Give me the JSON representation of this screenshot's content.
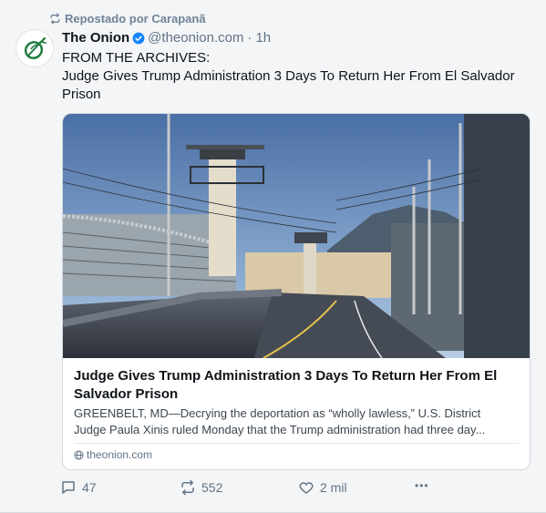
{
  "repost": {
    "label": "Repostado por Carapanã",
    "icon": "repost-icon"
  },
  "author": {
    "display_name": "The Onion",
    "verified": true,
    "handle": "@theonion.com",
    "separator": "·",
    "time": "1h",
    "avatar_icon": "onion-logo",
    "brand_color": "#1a7a3c"
  },
  "post": {
    "line1": "FROM THE ARCHIVES:",
    "line2": "Judge Gives Trump Administration 3 Days To Return Her From El Salvador Prison"
  },
  "card": {
    "image_alt": "prison watchtowers beside a road",
    "title": "Judge Gives Trump Administration 3 Days To Return Her From El Salvador Prison",
    "description_line1": "GREENBELT, MD—Decrying the deportation as “wholly lawless,” U.S. District",
    "description_line2": "Judge Paula Xinis ruled Monday that the Trump administration had three day...",
    "domain": "theonion.com",
    "domain_icon": "globe-icon"
  },
  "actions": {
    "reply_count": "47",
    "repost_count": "552",
    "like_count": "2 mil",
    "more_label": "•••"
  },
  "colors": {
    "background": "#f3f5f7",
    "muted": "#627486",
    "verified": "#1185fe"
  }
}
